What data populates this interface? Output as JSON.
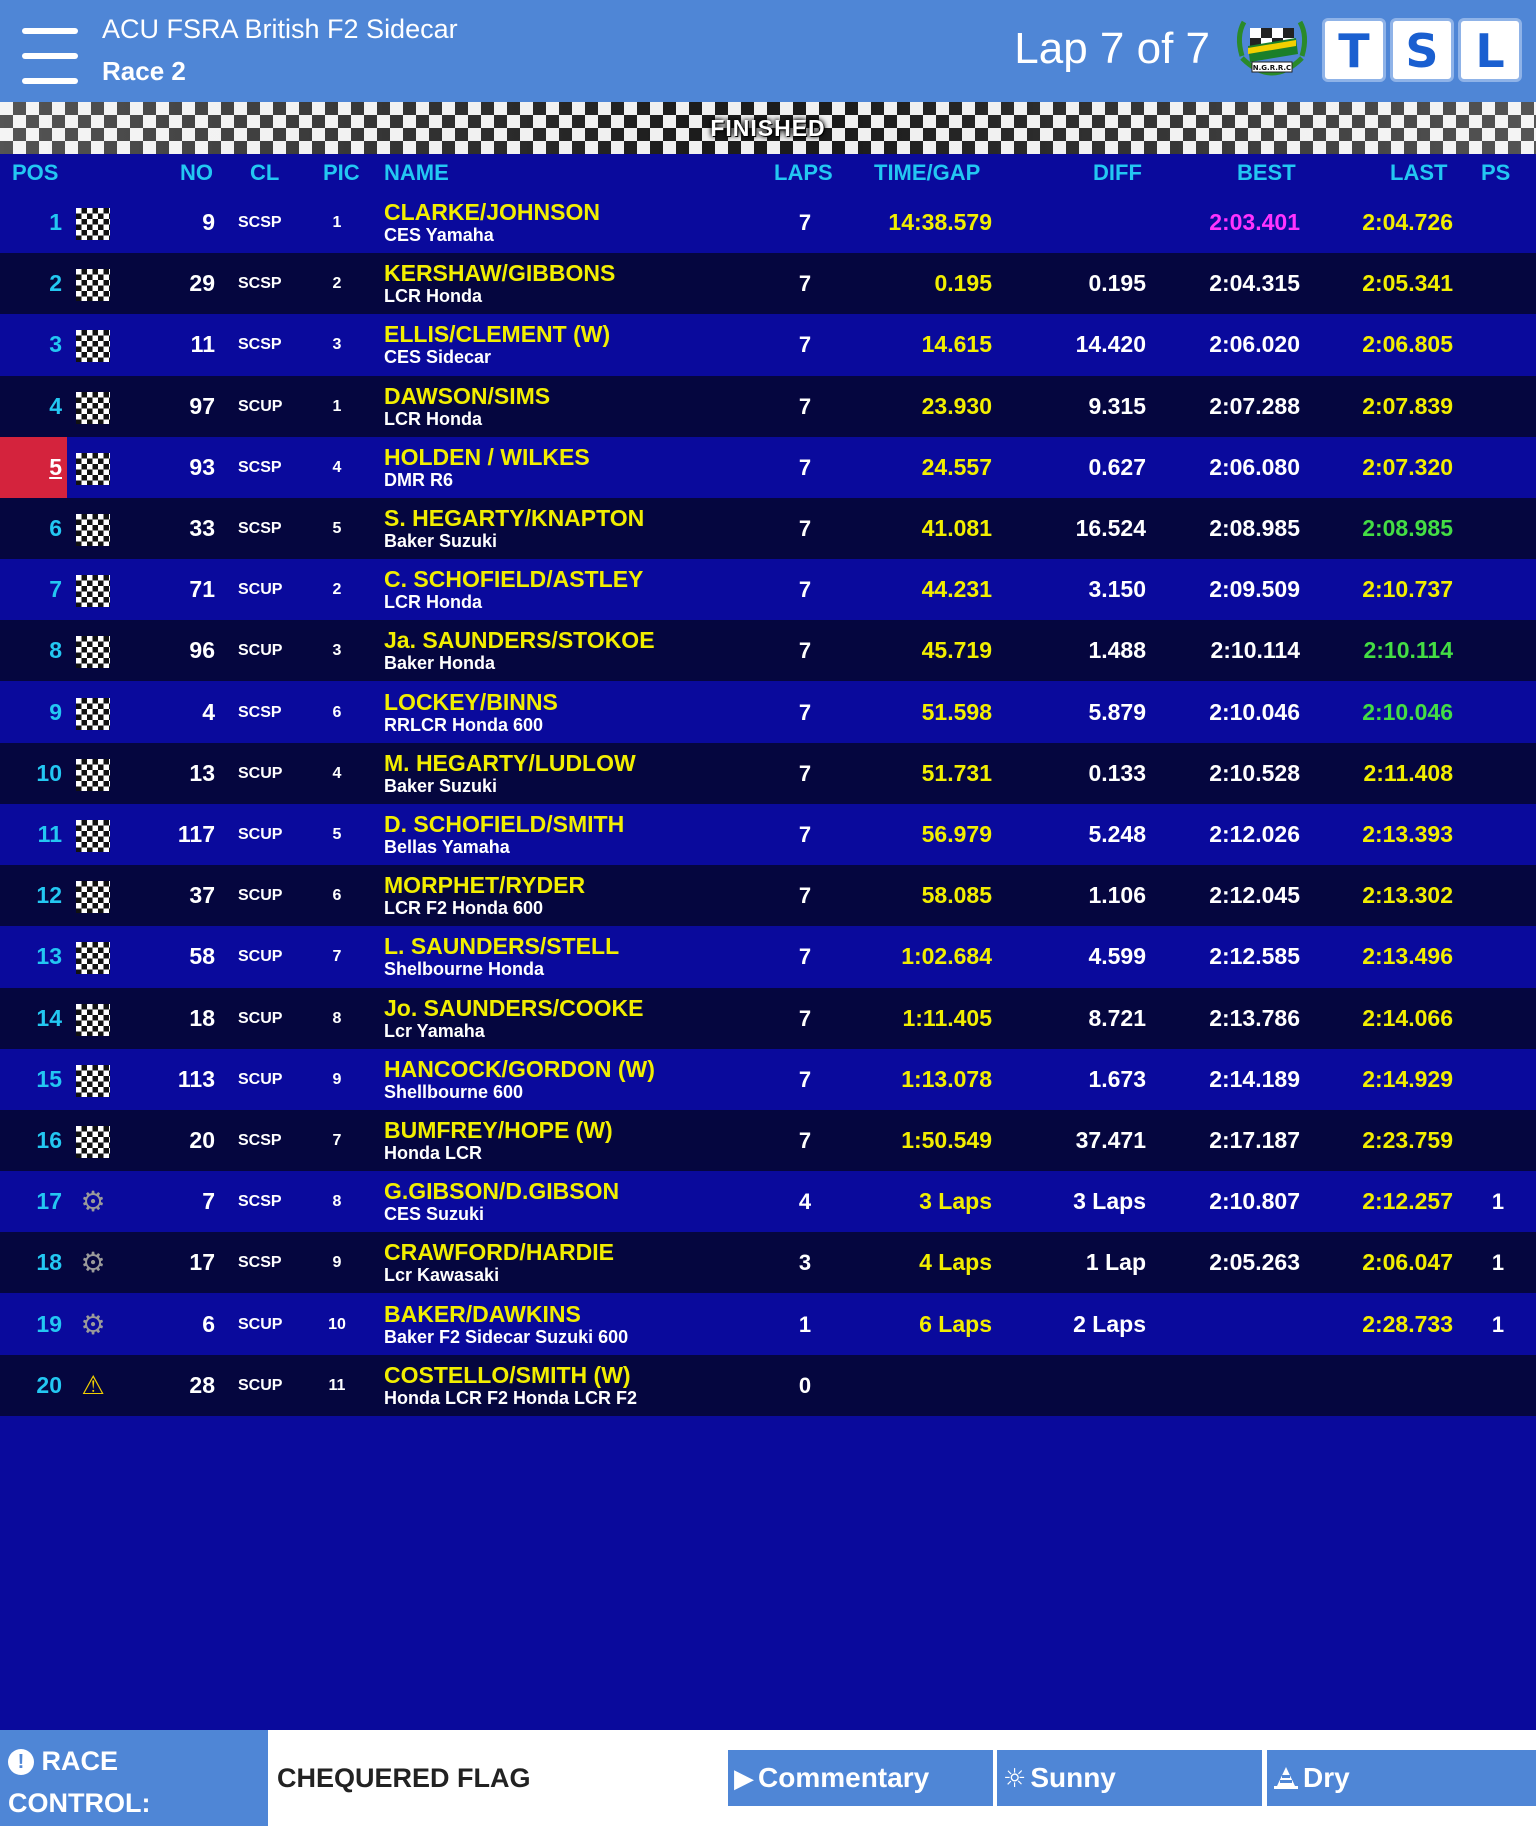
{
  "header": {
    "event": "ACU FSRA British F2 Sidecar",
    "race": "Race 2",
    "lap_counter": "Lap 7 of 7",
    "logo_text": "N.G.R.R.C",
    "buttons": [
      "T",
      "S",
      "L"
    ]
  },
  "flag_status": "FINISHED",
  "columns": {
    "pos": "POS",
    "no": "NO",
    "cl": "CL",
    "pic": "PIC",
    "name": "NAME",
    "laps": "LAPS",
    "time": "TIME/GAP",
    "diff": "DIFF",
    "best": "BEST",
    "last": "LAST",
    "ps": "PS"
  },
  "colors": {
    "header": "#4f86d6",
    "row_light": "#0a0a9c",
    "row_dark": "#05063f",
    "accent_cyan": "#23c7f2",
    "accent_yellow": "#f2ee00",
    "fastest_lap": "#ff33ff",
    "personal_best": "#44dd44",
    "marker_red": "#d4233d"
  },
  "rows": [
    {
      "pos": "1",
      "status": "chequered-flag",
      "no": "9",
      "cl": "SCSP",
      "pic": "1",
      "name": "CLARKE/JOHNSON",
      "team": "CES Yamaha",
      "laps": "7",
      "time": "14:38.579",
      "diff": "",
      "best": "2:03.401",
      "last": "2:04.726",
      "ps": "",
      "best_color": "#ff33ff",
      "last_color": "#f2ee00"
    },
    {
      "pos": "2",
      "status": "chequered-flag",
      "no": "29",
      "cl": "SCSP",
      "pic": "2",
      "name": "KERSHAW/GIBBONS",
      "team": "LCR Honda",
      "laps": "7",
      "time": "0.195",
      "diff": "0.195",
      "best": "2:04.315",
      "last": "2:05.341",
      "ps": ""
    },
    {
      "pos": "3",
      "status": "chequered-flag",
      "no": "11",
      "cl": "SCSP",
      "pic": "3",
      "name": "ELLIS/CLEMENT (W)",
      "team": "CES Sidecar",
      "laps": "7",
      "time": "14.615",
      "diff": "14.420",
      "best": "2:06.020",
      "last": "2:06.805",
      "ps": ""
    },
    {
      "pos": "4",
      "status": "chequered-flag",
      "no": "97",
      "cl": "SCUP",
      "pic": "1",
      "name": "DAWSON/SIMS",
      "team": "LCR Honda",
      "laps": "7",
      "time": "23.930",
      "diff": "9.315",
      "best": "2:07.288",
      "last": "2:07.839",
      "ps": ""
    },
    {
      "pos": "5",
      "status": "chequered-flag",
      "no": "93",
      "cl": "SCSP",
      "pic": "4",
      "name": "HOLDEN / WILKES",
      "team": "DMR R6",
      "laps": "7",
      "time": "24.557",
      "diff": "0.627",
      "best": "2:06.080",
      "last": "2:07.320",
      "ps": "",
      "highlight": true
    },
    {
      "pos": "6",
      "status": "chequered-flag",
      "no": "33",
      "cl": "SCSP",
      "pic": "5",
      "name": "S. HEGARTY/KNAPTON",
      "team": "Baker Suzuki",
      "laps": "7",
      "time": "41.081",
      "diff": "16.524",
      "best": "2:08.985",
      "last": "2:08.985",
      "ps": "",
      "last_color": "#44dd44"
    },
    {
      "pos": "7",
      "status": "chequered-flag",
      "no": "71",
      "cl": "SCUP",
      "pic": "2",
      "name": "C. SCHOFIELD/ASTLEY",
      "team": "LCR Honda",
      "laps": "7",
      "time": "44.231",
      "diff": "3.150",
      "best": "2:09.509",
      "last": "2:10.737",
      "ps": ""
    },
    {
      "pos": "8",
      "status": "chequered-flag",
      "no": "96",
      "cl": "SCUP",
      "pic": "3",
      "name": "Ja. SAUNDERS/STOKOE",
      "team": "Baker Honda",
      "laps": "7",
      "time": "45.719",
      "diff": "1.488",
      "best": "2:10.114",
      "last": "2:10.114",
      "ps": "",
      "last_color": "#44dd44"
    },
    {
      "pos": "9",
      "status": "chequered-flag",
      "no": "4",
      "cl": "SCSP",
      "pic": "6",
      "name": "LOCKEY/BINNS",
      "team": "RRLCR Honda 600",
      "laps": "7",
      "time": "51.598",
      "diff": "5.879",
      "best": "2:10.046",
      "last": "2:10.046",
      "ps": "",
      "last_color": "#44dd44"
    },
    {
      "pos": "10",
      "status": "chequered-flag",
      "no": "13",
      "cl": "SCUP",
      "pic": "4",
      "name": "M. HEGARTY/LUDLOW",
      "team": "Baker Suzuki",
      "laps": "7",
      "time": "51.731",
      "diff": "0.133",
      "best": "2:10.528",
      "last": "2:11.408",
      "ps": ""
    },
    {
      "pos": "11",
      "status": "chequered-flag",
      "no": "117",
      "cl": "SCUP",
      "pic": "5",
      "name": "D. SCHOFIELD/SMITH",
      "team": "Bellas Yamaha",
      "laps": "7",
      "time": "56.979",
      "diff": "5.248",
      "best": "2:12.026",
      "last": "2:13.393",
      "ps": ""
    },
    {
      "pos": "12",
      "status": "chequered-flag",
      "no": "37",
      "cl": "SCUP",
      "pic": "6",
      "name": "MORPHET/RYDER",
      "team": "LCR F2 Honda 600",
      "laps": "7",
      "time": "58.085",
      "diff": "1.106",
      "best": "2:12.045",
      "last": "2:13.302",
      "ps": ""
    },
    {
      "pos": "13",
      "status": "chequered-flag",
      "no": "58",
      "cl": "SCUP",
      "pic": "7",
      "name": "L. SAUNDERS/STELL",
      "team": "Shelbourne Honda",
      "laps": "7",
      "time": "1:02.684",
      "diff": "4.599",
      "best": "2:12.585",
      "last": "2:13.496",
      "ps": ""
    },
    {
      "pos": "14",
      "status": "chequered-flag",
      "no": "18",
      "cl": "SCUP",
      "pic": "8",
      "name": "Jo. SAUNDERS/COOKE",
      "team": "Lcr Yamaha",
      "laps": "7",
      "time": "1:11.405",
      "diff": "8.721",
      "best": "2:13.786",
      "last": "2:14.066",
      "ps": ""
    },
    {
      "pos": "15",
      "status": "chequered-flag",
      "no": "113",
      "cl": "SCUP",
      "pic": "9",
      "name": "HANCOCK/GORDON (W)",
      "team": "Shellbourne 600",
      "laps": "7",
      "time": "1:13.078",
      "diff": "1.673",
      "best": "2:14.189",
      "last": "2:14.929",
      "ps": ""
    },
    {
      "pos": "16",
      "status": "chequered-flag",
      "no": "20",
      "cl": "SCSP",
      "pic": "7",
      "name": "BUMFREY/HOPE (W)",
      "team": "Honda LCR",
      "laps": "7",
      "time": "1:50.549",
      "diff": "37.471",
      "best": "2:17.187",
      "last": "2:23.759",
      "ps": ""
    },
    {
      "pos": "17",
      "status": "retired",
      "no": "7",
      "cl": "SCSP",
      "pic": "8",
      "name": "G.GIBSON/D.GIBSON",
      "team": "CES Suzuki",
      "laps": "4",
      "time": "3 Laps",
      "diff": "3 Laps",
      "best": "2:10.807",
      "last": "2:12.257",
      "ps": "1"
    },
    {
      "pos": "18",
      "status": "retired",
      "no": "17",
      "cl": "SCSP",
      "pic": "9",
      "name": "CRAWFORD/HARDIE",
      "team": "Lcr Kawasaki",
      "laps": "3",
      "time": "4 Laps",
      "diff": "1 Lap",
      "best": "2:05.263",
      "last": "2:06.047",
      "ps": "1"
    },
    {
      "pos": "19",
      "status": "retired",
      "no": "6",
      "cl": "SCUP",
      "pic": "10",
      "name": "BAKER/DAWKINS",
      "team": "Baker F2 Sidecar Suzuki 600",
      "laps": "1",
      "time": "6 Laps",
      "diff": "2 Laps",
      "best": "",
      "last": "2:28.733",
      "ps": "1"
    },
    {
      "pos": "20",
      "status": "warning",
      "no": "28",
      "cl": "SCUP",
      "pic": "11",
      "name": "COSTELLO/SMITH (W)",
      "team": "Honda LCR F2 Honda LCR F2",
      "laps": "0",
      "time": "",
      "diff": "",
      "best": "",
      "last": "",
      "ps": ""
    }
  ],
  "footer": {
    "race_control_icon": "!",
    "race_control_label_1": "RACE",
    "race_control_label_2": "CONTROL:",
    "message": "CHEQUERED FLAG",
    "commentary_icon": "play-icon",
    "commentary": "Commentary",
    "weather_icon": "sun-icon",
    "weather": "Sunny",
    "track_icon": "track-cone-icon",
    "track": "Dry"
  }
}
